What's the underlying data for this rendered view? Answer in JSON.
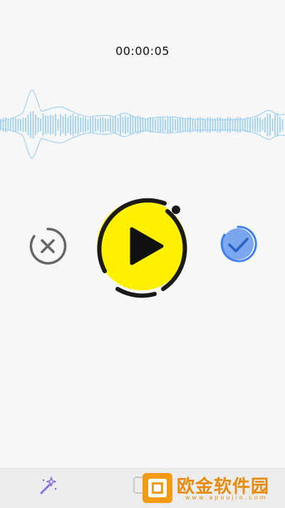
{
  "recorder": {
    "elapsed_time": "00:00:05",
    "waveform_color": "#a9d4ef"
  },
  "controls": {
    "play_color": "#ffef00",
    "confirm_color": "#3f7ff0",
    "cancel_color": "#666666"
  },
  "bottom_bar": {
    "effect_icon": "magic-wand-icon"
  },
  "watermark": {
    "name": "欧金软件园",
    "url": "www.apoujin.com",
    "color": "#f39b12"
  }
}
